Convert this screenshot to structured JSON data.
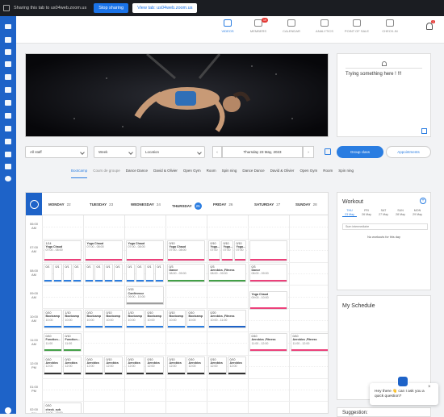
{
  "share_bar": {
    "text": "Sharing this tab to us04web.zoom.us",
    "stop_label": "Stop sharing",
    "view_label": "View tab: us04web.zoom.us"
  },
  "topnav": {
    "items": [
      {
        "label": "VIDEOS",
        "icon": "video-icon",
        "active": true
      },
      {
        "label": "MEMBERS",
        "icon": "members-icon",
        "badge": "19"
      },
      {
        "label": "CALENDAR",
        "icon": "calendar-icon"
      },
      {
        "label": "ANALYTICS",
        "icon": "analytics-icon"
      },
      {
        "label": "POINT OF SALE",
        "icon": "cart-icon"
      },
      {
        "label": "CHECK-IN",
        "icon": "checkin-icon"
      }
    ],
    "bell_badge": "1"
  },
  "note": {
    "message": "Trying something here ! !!!"
  },
  "filters": {
    "staff": "All staff",
    "view": "Week",
    "location": "Location",
    "date": "Thursday 23 May, 2023",
    "group_class": "Group class",
    "appointments": "Appointments"
  },
  "categories": [
    "Bootcamp",
    "Cours de groupe",
    "Dance Dance",
    "David & Olivier",
    "Open Gym",
    "Room",
    "Spin ning",
    "Dance Dance",
    "David & Olivier",
    "Open Gym",
    "Room",
    "Spin ning"
  ],
  "calendar": {
    "days": [
      {
        "name": "MONDAY",
        "num": "22"
      },
      {
        "name": "TUESDAY",
        "num": "23"
      },
      {
        "name": "WEDNESDAY",
        "num": "24"
      },
      {
        "name": "THURSDAY",
        "num": "25",
        "today": true
      },
      {
        "name": "FRIDAY",
        "num": "26"
      },
      {
        "name": "SATURDAY",
        "num": "27"
      },
      {
        "name": "SUNDAY",
        "num": "28"
      }
    ],
    "times": [
      "06:00 AM",
      "07:00 AM",
      "08:00 AM",
      "09:00 AM",
      "10:00 AM",
      "11:00 AM",
      "12:00 PM",
      "01:00 PM",
      "02:00 PM"
    ],
    "events": [
      {
        "day": 0,
        "row": 1.0,
        "h": 0.9,
        "sub": 0,
        "subs": 1,
        "cap": "1/14",
        "title": "Yoga Chaud",
        "time": "07:00 - 08:00",
        "color": "#ec407a"
      },
      {
        "day": 1,
        "row": 1.0,
        "h": 0.9,
        "sub": 0,
        "subs": 1,
        "cap": "",
        "title": "Yoga Chaud",
        "time": "07:00 - 08:00",
        "color": "#ec407a"
      },
      {
        "day": 2,
        "row": 1.0,
        "h": 0.9,
        "sub": 0,
        "subs": 1,
        "cap": "",
        "title": "Yoga Chaud",
        "time": "07:00 - 08:00",
        "color": "#ec407a"
      },
      {
        "day": 3,
        "row": 1.0,
        "h": 0.9,
        "sub": 0,
        "subs": 1,
        "cap": "0/10",
        "title": "Yoga Chaud",
        "time": "07:00 - 08:00",
        "color": "#ec407a"
      },
      {
        "day": 4,
        "row": 1.0,
        "h": 0.9,
        "sub": 0,
        "subs": 3,
        "cap": "0/10",
        "title": "Yoga...",
        "time": "07:00",
        "color": "#ec407a"
      },
      {
        "day": 4,
        "row": 1.0,
        "h": 0.9,
        "sub": 1,
        "subs": 3,
        "cap": "0/10",
        "title": "Yoga...",
        "time": "07:00",
        "color": "#ec407a"
      },
      {
        "day": 4,
        "row": 1.0,
        "h": 0.9,
        "sub": 2,
        "subs": 3,
        "cap": "0/10",
        "title": "Yoga...",
        "time": "07:00",
        "color": "#ec407a"
      },
      {
        "day": 5,
        "row": 1.0,
        "h": 0.9,
        "sub": 0,
        "subs": 1,
        "cap": "",
        "title": "",
        "time": "",
        "color": "#ec407a"
      },
      {
        "day": 0,
        "row": 2.0,
        "h": 0.8,
        "sub": 0,
        "subs": 4,
        "cap": "0/1",
        "title": "",
        "time": "",
        "color": "#2a7de1"
      },
      {
        "day": 0,
        "row": 2.0,
        "h": 0.8,
        "sub": 1,
        "subs": 4,
        "cap": "0/1",
        "title": "",
        "time": "",
        "color": "#2a7de1"
      },
      {
        "day": 0,
        "row": 2.0,
        "h": 0.8,
        "sub": 2,
        "subs": 4,
        "cap": "0/1",
        "title": "",
        "time": "",
        "color": "#2a7de1"
      },
      {
        "day": 0,
        "row": 2.0,
        "h": 0.8,
        "sub": 3,
        "subs": 4,
        "cap": "0/1",
        "title": "",
        "time": "",
        "color": "#2a7de1"
      },
      {
        "day": 1,
        "row": 2.0,
        "h": 0.8,
        "sub": 0,
        "subs": 4,
        "cap": "0/1",
        "title": "",
        "time": "",
        "color": "#2a7de1"
      },
      {
        "day": 1,
        "row": 2.0,
        "h": 0.8,
        "sub": 1,
        "subs": 4,
        "cap": "0/1",
        "title": "",
        "time": "",
        "color": "#2a7de1"
      },
      {
        "day": 1,
        "row": 2.0,
        "h": 0.8,
        "sub": 2,
        "subs": 4,
        "cap": "0/1",
        "title": "",
        "time": "",
        "color": "#2a7de1"
      },
      {
        "day": 1,
        "row": 2.0,
        "h": 0.8,
        "sub": 3,
        "subs": 4,
        "cap": "0/1",
        "title": "",
        "time": "",
        "color": "#2a7de1"
      },
      {
        "day": 2,
        "row": 2.0,
        "h": 0.8,
        "sub": 0,
        "subs": 4,
        "cap": "0/1",
        "title": "",
        "time": "",
        "color": "#2a7de1"
      },
      {
        "day": 2,
        "row": 2.0,
        "h": 0.8,
        "sub": 1,
        "subs": 4,
        "cap": "0/1",
        "title": "",
        "time": "",
        "color": "#2a7de1"
      },
      {
        "day": 2,
        "row": 2.0,
        "h": 0.8,
        "sub": 2,
        "subs": 4,
        "cap": "0/1",
        "title": "",
        "time": "",
        "color": "#2a7de1"
      },
      {
        "day": 2,
        "row": 2.0,
        "h": 0.8,
        "sub": 3,
        "subs": 4,
        "cap": "0/1",
        "title": "",
        "time": "",
        "color": "#2a7de1"
      },
      {
        "day": 3,
        "row": 2.0,
        "h": 0.8,
        "sub": 0,
        "subs": 1,
        "cap": "0/3",
        "title": "Dance",
        "time": "08:00 - 09:00",
        "color": "#43a047"
      },
      {
        "day": 4,
        "row": 2.0,
        "h": 0.8,
        "sub": 0,
        "subs": 1,
        "cap": "0/3",
        "title": "Aerobics ,Fitness",
        "time": "08:00 - 09:00",
        "color": "#43a047"
      },
      {
        "day": 5,
        "row": 2.0,
        "h": 0.8,
        "sub": 0,
        "subs": 1,
        "cap": "0/3",
        "title": "Dance",
        "time": "08:00 - 09:00",
        "color": "#ec407a"
      },
      {
        "day": 2,
        "row": 3.0,
        "h": 0.8,
        "sub": 0,
        "subs": 1,
        "cap": "0/15",
        "title": "Conférence",
        "time": "09:00 - 10:00",
        "color": "#9e9e9e"
      },
      {
        "day": 5,
        "row": 3.2,
        "h": 0.8,
        "sub": 0,
        "subs": 1,
        "cap": "",
        "title": "Yoga Chaud",
        "time": "09:00 - 10:00",
        "color": "#ec407a"
      },
      {
        "day": 0,
        "row": 4.0,
        "h": 0.8,
        "sub": 0,
        "subs": 2,
        "cap": "0/10",
        "title": "Bootcamp",
        "time": "10:00",
        "color": "#2a7de1"
      },
      {
        "day": 0,
        "row": 4.0,
        "h": 0.8,
        "sub": 1,
        "subs": 2,
        "cap": "1/10",
        "title": "Bootcamp",
        "time": "10:00",
        "color": "#2a7de1"
      },
      {
        "day": 1,
        "row": 4.0,
        "h": 0.8,
        "sub": 0,
        "subs": 2,
        "cap": "0/10",
        "title": "Bootcamp",
        "time": "10:00",
        "color": "#2a7de1"
      },
      {
        "day": 1,
        "row": 4.0,
        "h": 0.8,
        "sub": 1,
        "subs": 2,
        "cap": "0/10",
        "title": "Bootcamp",
        "time": "10:00",
        "color": "#2a7de1"
      },
      {
        "day": 2,
        "row": 4.0,
        "h": 0.8,
        "sub": 0,
        "subs": 2,
        "cap": "1/10",
        "title": "Bootcamp",
        "time": "10:00",
        "color": "#2a7de1"
      },
      {
        "day": 2,
        "row": 4.0,
        "h": 0.8,
        "sub": 1,
        "subs": 2,
        "cap": "0/10",
        "title": "Bootcamp",
        "time": "10:00",
        "color": "#2a7de1"
      },
      {
        "day": 3,
        "row": 4.0,
        "h": 0.8,
        "sub": 0,
        "subs": 2,
        "cap": "0/10",
        "title": "Bootcamp",
        "time": "10:00",
        "color": "#2a7de1"
      },
      {
        "day": 3,
        "row": 4.0,
        "h": 0.8,
        "sub": 1,
        "subs": 2,
        "cap": "0/10",
        "title": "Bootcamp",
        "time": "10:00",
        "color": "#2a7de1"
      },
      {
        "day": 4,
        "row": 4.0,
        "h": 0.8,
        "sub": 0,
        "subs": 1,
        "cap": "0/20",
        "title": "Aerobics ,Fitness",
        "time": "10:00 - 11:00",
        "color": "#1e63c8"
      },
      {
        "day": 0,
        "row": 5.0,
        "h": 0.8,
        "sub": 0,
        "subs": 2,
        "cap": "0/10",
        "title": "Function...",
        "time": "11:00",
        "color": "#43a047"
      },
      {
        "day": 0,
        "row": 5.0,
        "h": 0.8,
        "sub": 1,
        "subs": 2,
        "cap": "0/10",
        "title": "Function...",
        "time": "11:00",
        "color": "#43a047"
      },
      {
        "day": 5,
        "row": 5.0,
        "h": 0.8,
        "sub": 0,
        "subs": 1,
        "cap": "0/10",
        "title": "Aerobics ,Fitness",
        "time": "11:00 - 12:00",
        "color": "#ec407a"
      },
      {
        "day": 6,
        "row": 5.0,
        "h": 0.8,
        "sub": 0,
        "subs": 1,
        "cap": "0/10",
        "title": "Aerobics ,Fitness",
        "time": "11:00 - 12:00",
        "color": "#ec407a"
      },
      {
        "day": 0,
        "row": 6.0,
        "h": 0.8,
        "sub": 0,
        "subs": 2,
        "cap": "0/10",
        "title": "Aerobics",
        "time": "12:00",
        "color": "#333"
      },
      {
        "day": 0,
        "row": 6.0,
        "h": 0.8,
        "sub": 1,
        "subs": 2,
        "cap": "0/10",
        "title": "Aerobics",
        "time": "12:00",
        "color": "#333"
      },
      {
        "day": 1,
        "row": 6.0,
        "h": 0.8,
        "sub": 0,
        "subs": 2,
        "cap": "0/10",
        "title": "Aerobics",
        "time": "12:00",
        "color": "#333"
      },
      {
        "day": 1,
        "row": 6.0,
        "h": 0.8,
        "sub": 1,
        "subs": 2,
        "cap": "0/10",
        "title": "Aerobics",
        "time": "12:00",
        "color": "#333"
      },
      {
        "day": 2,
        "row": 6.0,
        "h": 0.8,
        "sub": 0,
        "subs": 2,
        "cap": "0/10",
        "title": "Aerobics",
        "time": "12:00",
        "color": "#333"
      },
      {
        "day": 2,
        "row": 6.0,
        "h": 0.8,
        "sub": 1,
        "subs": 2,
        "cap": "0/10",
        "title": "Aerobics",
        "time": "12:00",
        "color": "#333"
      },
      {
        "day": 3,
        "row": 6.0,
        "h": 0.8,
        "sub": 0,
        "subs": 2,
        "cap": "0/10",
        "title": "Aerobics",
        "time": "12:00",
        "color": "#333"
      },
      {
        "day": 3,
        "row": 6.0,
        "h": 0.8,
        "sub": 1,
        "subs": 2,
        "cap": "0/10",
        "title": "Aerobics",
        "time": "12:00",
        "color": "#333"
      },
      {
        "day": 4,
        "row": 6.0,
        "h": 0.8,
        "sub": 0,
        "subs": 2,
        "cap": "0/10",
        "title": "Aerobics",
        "time": "12:00",
        "color": "#333"
      },
      {
        "day": 4,
        "row": 6.0,
        "h": 0.8,
        "sub": 1,
        "subs": 2,
        "cap": "0/10",
        "title": "Aerobics",
        "time": "12:00",
        "color": "#333"
      },
      {
        "day": 0,
        "row": 8.0,
        "h": 0.8,
        "sub": 0,
        "subs": 1,
        "cap": "0/10",
        "title": "check_sub",
        "time": "14:00 - 15:00",
        "color": "#9e9e9e"
      }
    ]
  },
  "workout": {
    "title": "Workout",
    "days": [
      {
        "dow": "THU",
        "date": "23 May",
        "active": true
      },
      {
        "dow": "FRI",
        "date": "26 May"
      },
      {
        "dow": "SAT",
        "date": "27 May"
      },
      {
        "dow": "SUN",
        "date": "28 May"
      },
      {
        "dow": "MON",
        "date": "29 May"
      }
    ],
    "select": "Sum intermediaire",
    "empty": "No workouts for this day"
  },
  "schedule": {
    "title": "My Schedule"
  },
  "suggestion": {
    "title": "Suggestion:"
  },
  "chat": {
    "message": "Hey there 👋 can I ask you a quick question?",
    "close": "×"
  }
}
